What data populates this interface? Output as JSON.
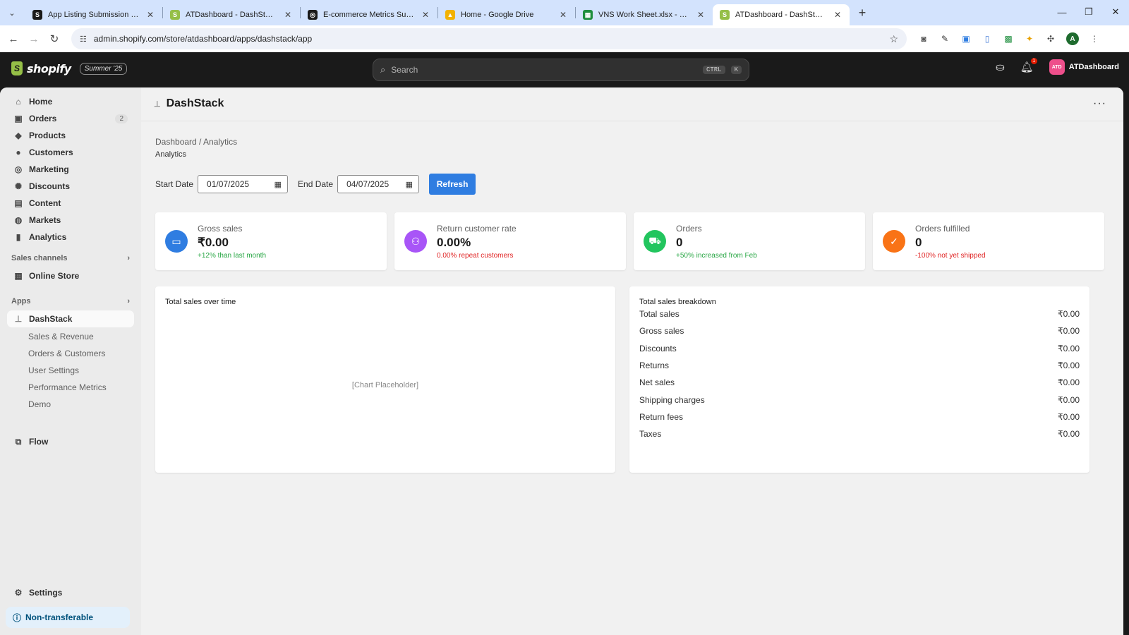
{
  "browser": {
    "tabs": [
      {
        "title": "App Listing Submission | Shopify",
        "fav_color": "#1a1a1a",
        "fav_glyph": "S"
      },
      {
        "title": "ATDashboard - DashStack - Shopify",
        "fav_color": "#95bf47",
        "fav_glyph": "S"
      },
      {
        "title": "E-commerce Metrics Summary",
        "fav_color": "#1a1a1a",
        "fav_glyph": "◎"
      },
      {
        "title": "Home - Google Drive",
        "fav_color": "#f2b203",
        "fav_glyph": "▲"
      },
      {
        "title": "VNS Work Sheet.xlsx - Google Sheets",
        "fav_color": "#1e8e3e",
        "fav_glyph": "▦"
      },
      {
        "title": "ATDashboard - DashStack - Shopify",
        "fav_color": "#95bf47",
        "fav_glyph": "S"
      }
    ],
    "active_tab": 5,
    "url": "admin.shopify.com/store/atdashboard/apps/dashstack/app",
    "profile_initial": "A"
  },
  "topbar": {
    "logo_text": "shopify",
    "badge": "Summer '25",
    "search_placeholder": "Search",
    "shortcut_ctrl": "CTRL",
    "shortcut_key": "K",
    "notification_count": "1",
    "store_initials": "ATD",
    "store_name": "ATDashboard"
  },
  "sidebar": {
    "items": [
      {
        "label": "Home",
        "icon": "home-icon",
        "glyph": "⌂"
      },
      {
        "label": "Orders",
        "icon": "inbox-icon",
        "glyph": "▣",
        "count": "2"
      },
      {
        "label": "Products",
        "icon": "tag-icon",
        "glyph": "◆"
      },
      {
        "label": "Customers",
        "icon": "person-icon",
        "glyph": "●"
      },
      {
        "label": "Marketing",
        "icon": "target-icon",
        "glyph": "◎"
      },
      {
        "label": "Discounts",
        "icon": "discount-icon",
        "glyph": "✺"
      },
      {
        "label": "Content",
        "icon": "content-icon",
        "glyph": "▤"
      },
      {
        "label": "Markets",
        "icon": "globe-icon",
        "glyph": "◍"
      },
      {
        "label": "Analytics",
        "icon": "bar-chart-icon",
        "glyph": "▮"
      }
    ],
    "sales_channels_label": "Sales channels",
    "online_store_label": "Online Store",
    "apps_label": "Apps",
    "app_name": "DashStack",
    "app_subitems": [
      "Sales & Revenue",
      "Orders & Customers",
      "User Settings",
      "Performance Metrics",
      "Demo"
    ],
    "flow_label": "Flow",
    "settings_label": "Settings",
    "non_transferable_label": "Non-transferable"
  },
  "app": {
    "title": "DashStack",
    "more_label": "···",
    "breadcrumb": "Dashboard / Analytics",
    "subtitle": "Analytics",
    "start_label": "Start Date",
    "start_value": "01/07/2025",
    "end_label": "End Date",
    "end_value": "04/07/2025",
    "refresh_label": "Refresh"
  },
  "kpis": [
    {
      "label": "Gross sales",
      "value": "₹0.00",
      "note": "+12% than last month",
      "trend": "up",
      "color": "#2f7de1",
      "icon": "money-icon",
      "glyph": "▭"
    },
    {
      "label": "Return customer rate",
      "value": "0.00%",
      "note": "0.00% repeat customers",
      "trend": "down",
      "color": "#a855f7",
      "icon": "users-icon",
      "glyph": "⚇"
    },
    {
      "label": "Orders",
      "value": "0",
      "note": "+50% increased from Feb",
      "trend": "up",
      "color": "#22c55e",
      "icon": "cart-icon",
      "glyph": "⛟"
    },
    {
      "label": "Orders fulfilled",
      "value": "0",
      "note": "-100% not yet shipped",
      "trend": "down",
      "color": "#f97316",
      "icon": "check-circle-icon",
      "glyph": "✓"
    }
  ],
  "chart_panel": {
    "title": "Total sales over time",
    "placeholder": "[Chart Placeholder]"
  },
  "breakdown": {
    "title": "Total sales breakdown",
    "rows": [
      {
        "label": "Total sales",
        "value": "₹0.00"
      },
      {
        "label": "Gross sales",
        "value": "₹0.00"
      },
      {
        "label": "Discounts",
        "value": "₹0.00"
      },
      {
        "label": "Returns",
        "value": "₹0.00"
      },
      {
        "label": "Net sales",
        "value": "₹0.00"
      },
      {
        "label": "Shipping charges",
        "value": "₹0.00"
      },
      {
        "label": "Return fees",
        "value": "₹0.00"
      },
      {
        "label": "Taxes",
        "value": "₹0.00"
      }
    ]
  }
}
